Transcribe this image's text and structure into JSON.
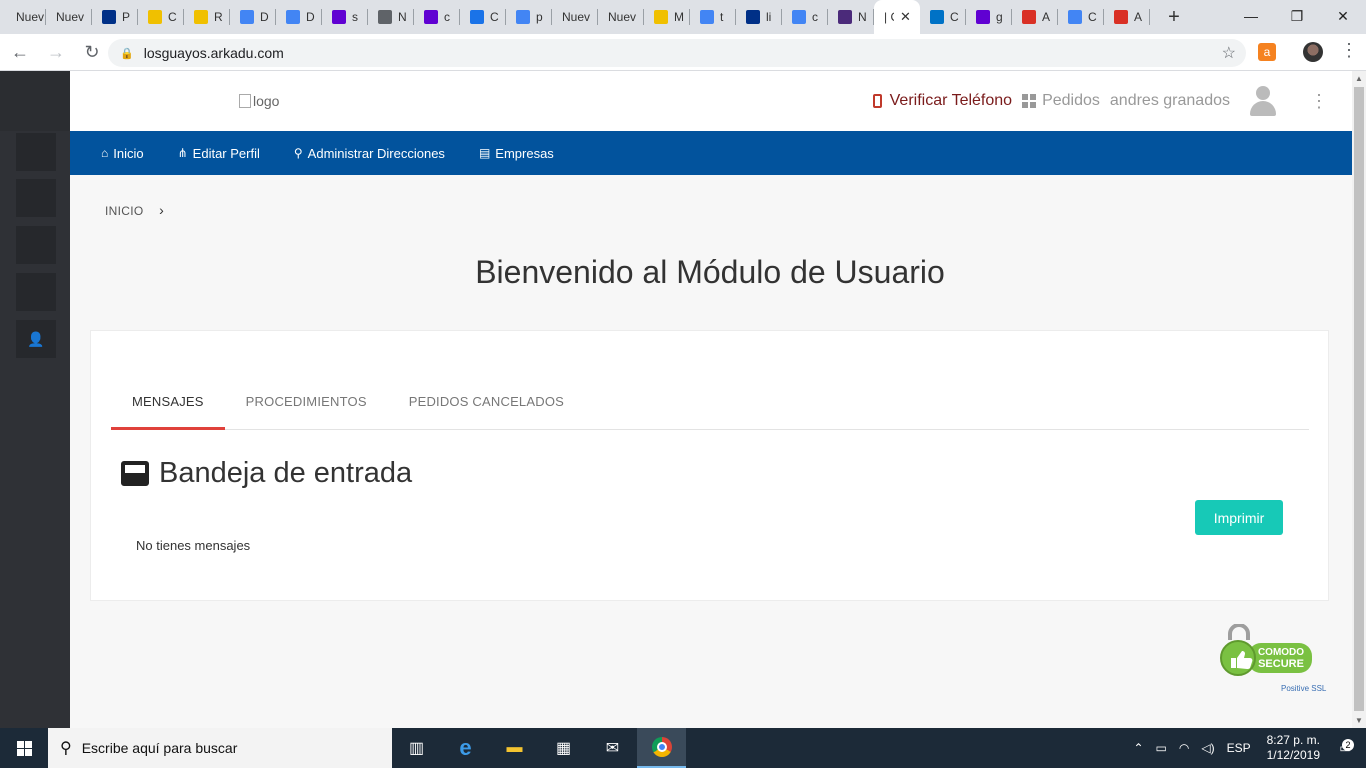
{
  "browser": {
    "tabs": [
      {
        "title": "Nuev",
        "favicon_color": "#dee1e6"
      },
      {
        "title": "Nuev",
        "favicon_color": "#dee1e6"
      },
      {
        "title": "P",
        "favicon_color": "#003087"
      },
      {
        "title": "C",
        "favicon_color": "#f0c000"
      },
      {
        "title": "R",
        "favicon_color": "#f0c000"
      },
      {
        "title": "D",
        "favicon_color": "#4285f4"
      },
      {
        "title": "D",
        "favicon_color": "#4285f4"
      },
      {
        "title": "s",
        "favicon_color": "#6001d2"
      },
      {
        "title": "N",
        "favicon_color": "#5f6368"
      },
      {
        "title": "c",
        "favicon_color": "#6001d2"
      },
      {
        "title": "C",
        "favicon_color": "#1a73e8"
      },
      {
        "title": "p",
        "favicon_color": "#4285f4"
      },
      {
        "title": "Nuev",
        "favicon_color": "#dee1e6"
      },
      {
        "title": "Nuev",
        "favicon_color": "#dee1e6"
      },
      {
        "title": "M",
        "favicon_color": "#f0c000"
      },
      {
        "title": "t",
        "favicon_color": "#4285f4"
      },
      {
        "title": "li",
        "favicon_color": "#003087"
      },
      {
        "title": "c",
        "favicon_color": "#4285f4"
      },
      {
        "title": "N",
        "favicon_color": "#4b2a7a"
      },
      {
        "title": "| C",
        "favicon_color": "#ffffff",
        "active": true
      },
      {
        "title": "C",
        "favicon_color": "#0072c6"
      },
      {
        "title": "g",
        "favicon_color": "#6001d2"
      },
      {
        "title": "A",
        "favicon_color": "#d93025"
      },
      {
        "title": "C",
        "favicon_color": "#4285f4"
      },
      {
        "title": "A",
        "favicon_color": "#d93025"
      }
    ],
    "close_tab_glyph": "✕",
    "new_tab_glyph": "+",
    "url": "losguayos.arkadu.com",
    "back_glyph": "←",
    "forward_glyph": "→",
    "reload_glyph": "↻",
    "lock_glyph": "🔒",
    "star_glyph": "☆",
    "menu_glyph": "⋮",
    "window": {
      "minimize": "—",
      "restore": "❐",
      "close": "✕"
    }
  },
  "header": {
    "logo_alt": "logo",
    "verify_phone": "Verificar Teléfono",
    "orders": "Pedidos",
    "username": "andres granados",
    "kebab": "⋮"
  },
  "navbar": {
    "items": [
      {
        "icon": "⌂",
        "label": "Inicio"
      },
      {
        "icon": "⋔",
        "label": "Editar Perfil"
      },
      {
        "icon": "⚲",
        "label": "Administrar Direcciones"
      },
      {
        "icon": "▤",
        "label": "Empresas"
      }
    ]
  },
  "breadcrumb": {
    "label": "INICIO",
    "chevron": "›"
  },
  "page_title": "Bienvenido al Módulo de Usuario",
  "card": {
    "tabs": [
      "MENSAJES",
      "PROCEDIMIENTOS",
      "PEDIDOS CANCELADOS"
    ],
    "inbox_title": "Bandeja de entrada",
    "print_button": "Imprimir",
    "empty_message": "No tienes mensajes"
  },
  "seal": {
    "brand": "COMODO",
    "label": "SECURE",
    "caption": "Positive SSL"
  },
  "sidebar": {
    "user_icon": "👤"
  },
  "taskbar": {
    "search_placeholder": "Escribe aquí para buscar",
    "language": "ESP",
    "time": "8:27 p. m.",
    "date": "1/12/2019",
    "notifications": "2"
  },
  "colors": {
    "navbar": "#02539d",
    "print_button": "#17c9b7",
    "active_tab_underline": "#e0413b",
    "sidebar": "#2f3136"
  }
}
